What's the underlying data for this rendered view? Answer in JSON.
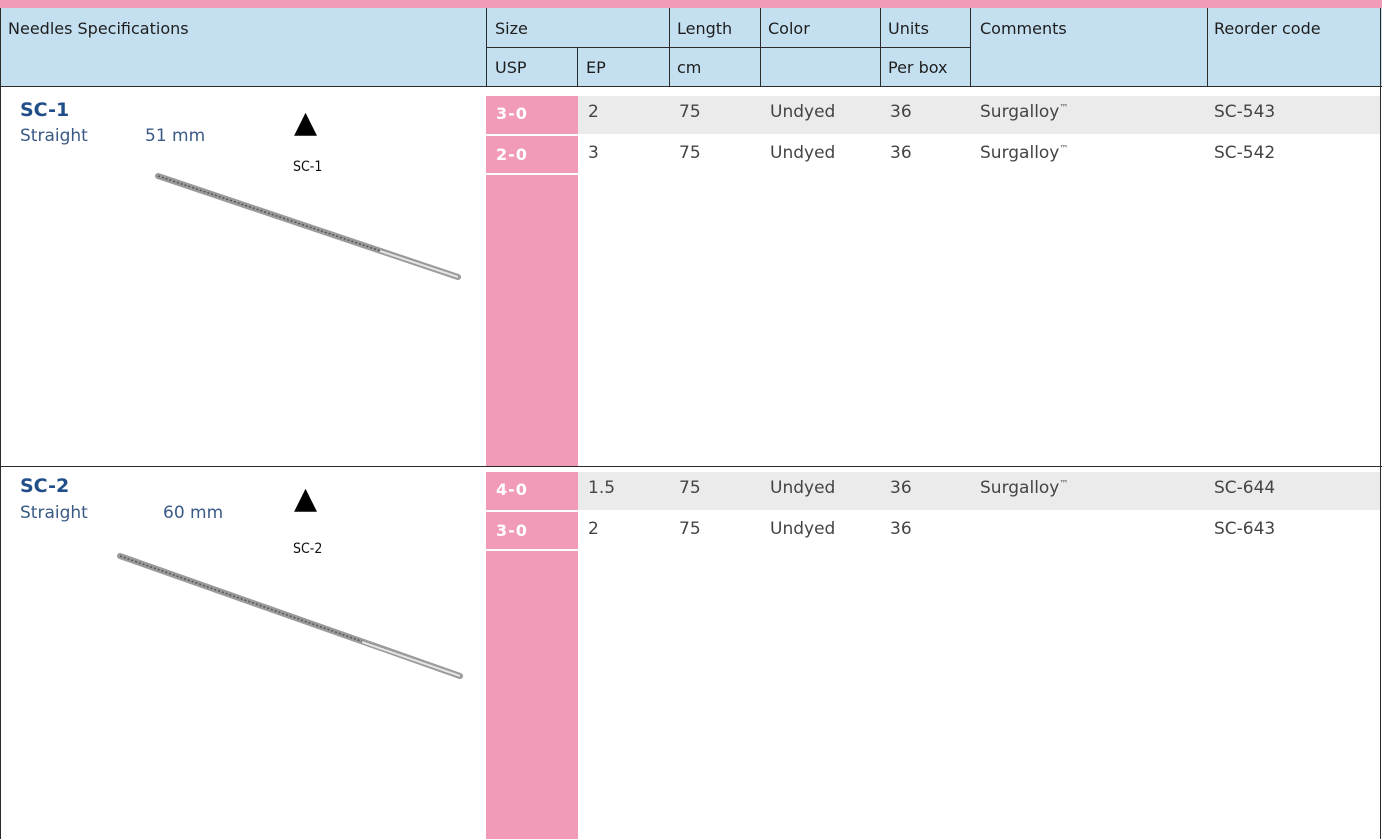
{
  "table": {
    "headers": {
      "spec": "Needles Specifications",
      "size": "Size",
      "usp": "USP",
      "ep": "EP",
      "length": "Length",
      "length_unit": "cm",
      "color": "Color",
      "units": "Units",
      "units_sub": "Per box",
      "comments": "Comments",
      "reorder": "Reorder code"
    },
    "needles": [
      {
        "name": "SC-1",
        "shape": "Straight",
        "size": "51 mm",
        "image_label": "SC-1",
        "rows": [
          {
            "usp": "3-0",
            "ep": "2",
            "length": "75",
            "color": "Undyed",
            "units": "36",
            "comment": "Surgalloy",
            "tm": "™",
            "code": "SC-543"
          },
          {
            "usp": "2-0",
            "ep": "3",
            "length": "75",
            "color": "Undyed",
            "units": "36",
            "comment": "Surgalloy",
            "tm": "™",
            "code": "SC-542"
          }
        ]
      },
      {
        "name": "SC-2",
        "shape": "Straight",
        "size": "60 mm",
        "image_label": "SC-2",
        "rows": [
          {
            "usp": "4-0",
            "ep": "1.5",
            "length": "75",
            "color": "Undyed",
            "units": "36",
            "comment": "Surgalloy",
            "tm": "™",
            "code": "SC-644"
          },
          {
            "usp": "3-0",
            "ep": "2",
            "length": "75",
            "color": "Undyed",
            "units": "36",
            "comment": "",
            "tm": "",
            "code": "SC-643"
          }
        ]
      }
    ]
  },
  "icons": {
    "point_marker": "black-triangle-icon",
    "needle": "straight-needle-icon"
  },
  "colors": {
    "accent_pink": "#f29bb8",
    "header_blue": "#c4dfef",
    "name_blue": "#1f4e89",
    "stripe_gray": "#ebebeb"
  }
}
